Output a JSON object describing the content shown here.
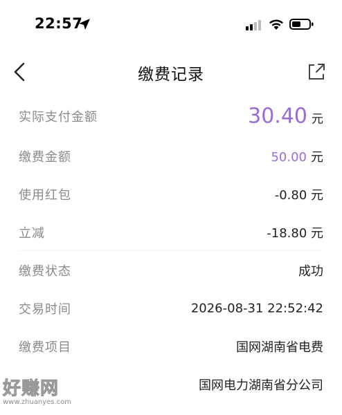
{
  "status_bar": {
    "time": "22:57",
    "icons": [
      "location-arrow-icon",
      "signal-icon",
      "wifi-icon",
      "battery-icon"
    ]
  },
  "nav": {
    "title": "缴费记录",
    "back_icon": "chevron-left-icon",
    "share_icon": "share-icon"
  },
  "record": {
    "actual_paid": {
      "label": "实际支付金额",
      "value": "30.40",
      "unit": "元"
    },
    "fee_amount": {
      "label": "缴费金额",
      "value": "50.00",
      "unit": "元"
    },
    "red_packet": {
      "label": "使用红包",
      "value": "-0.80 元"
    },
    "instant_discount": {
      "label": "立减",
      "value": "-18.80 元"
    },
    "status": {
      "label": "缴费状态",
      "value": "成功"
    },
    "time": {
      "label": "交易时间",
      "value": "2026-08-31 22:52:42"
    },
    "item": {
      "label": "缴费项目",
      "value": "国网湖南省电费"
    },
    "company": {
      "label": "",
      "value": "国网电力湖南省分公司"
    }
  },
  "watermark": {
    "main": "好赚网",
    "sub": "www.zhuanyes.com"
  },
  "colors": {
    "accent_purple": "#9a6bd6",
    "label_gray": "#8a8a8a",
    "text_dark": "#222222"
  }
}
